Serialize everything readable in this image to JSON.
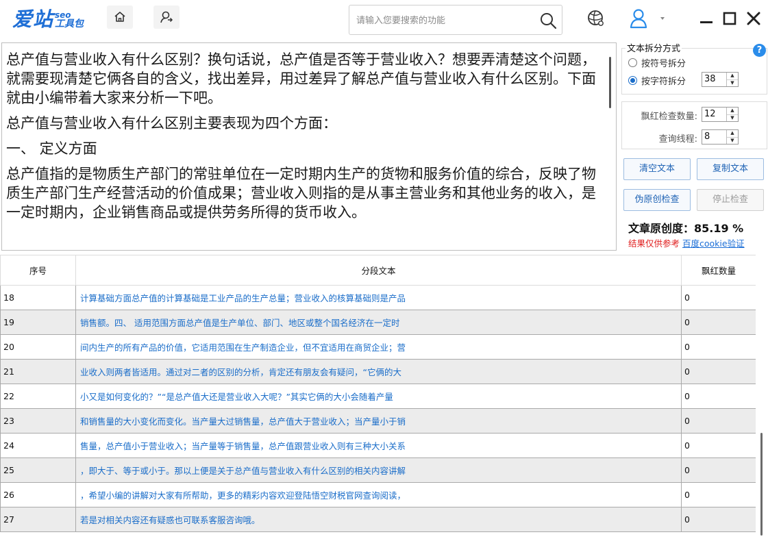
{
  "app": {
    "logo_main": "爱站",
    "logo_seo": "seo",
    "logo_tool": "工具包"
  },
  "header": {
    "search_placeholder": "请输入您要搜索的功能",
    "icons": [
      "home-icon",
      "share-icon",
      "search-icon",
      "globe-icon",
      "user-icon",
      "minimize-icon",
      "maximize-icon",
      "close-icon"
    ]
  },
  "editor": {
    "paragraphs": [
      "总产值与营业收入有什么区别？换句话说，总产值是否等于营业收入？想要弄清楚这个问题，就需要现清楚它俩各自的含义，找出差异，用过差异了解总产值与营业收入有什么区别。下面就由小编带着大家来分析一下吧。",
      "总产值与营业收入有什么区别主要表现为四个方面：",
      "一、 定义方面",
      "总产值指的是物质生产部门的常驻单位在一定时期内生产的货物和服务价值的综合，反映了物质生产部门生产经营活动的价值成果；营业收入则指的是从事主营业务和其他业务的收入，是一定时期内，企业销售商品或提供劳务所得的货币收入。"
    ]
  },
  "panel": {
    "split_title": "文本拆分方式",
    "radio_symbol": "按符号拆分",
    "radio_char": "按字符拆分",
    "char_count": "38",
    "red_check_label": "飘红检查数量:",
    "red_check_value": "12",
    "threads_label": "查询线程:",
    "threads_value": "8",
    "btn_clear": "清空文本",
    "btn_copy": "复制文本",
    "btn_check": "伪原创检查",
    "btn_stop": "停止检查",
    "originality": "文章原创度：85.19 %",
    "note_red": "结果仅供参考",
    "note_link": "百度cookie验证",
    "accent_color": "#1a6dc9",
    "warning_color": "#e02020"
  },
  "table": {
    "headers": [
      "序号",
      "分段文本",
      "飘红数量"
    ],
    "rows": [
      [
        "18",
        "计算基础方面总产值的计算基础是工业产品的生产总量；营业收入的核算基础则是产品",
        "0"
      ],
      [
        "19",
        "销售额。四、 适用范围方面总产值是生产单位、部门、地区或整个国名经济在一定时",
        "0"
      ],
      [
        "20",
        "间内生产的所有产品的价值，它适用范围在生产制造企业，但不宜适用在商贸企业；营",
        "0"
      ],
      [
        "21",
        "业收入则两者皆适用。通过对二者的区别的分析，肯定还有朋友会有疑问，“它俩的大",
        "0"
      ],
      [
        "22",
        "小又是如何变化的？”“是总产值大还是营业收入大呢？”其实它俩的大小会随着产量",
        "0"
      ],
      [
        "23",
        "和销售量的大小变化而变化。当产量大过销售量，总产值大于营业收入；当产量小于销",
        "0"
      ],
      [
        "24",
        "售量，总产值小于营业收入；当产量等于销售量，总产值跟营业收入则有三种大小关系",
        "0"
      ],
      [
        "25",
        "，即大于、等于或小于。那以上便是关于总产值与营业收入有什么区别的相关内容讲解",
        "0"
      ],
      [
        "26",
        "，希望小编的讲解对大家有所帮助，更多的精彩内容欢迎登陆悟空财税官网查询阅读，",
        "0"
      ],
      [
        "27",
        "若是对相关内容还有疑惑也可联系客服咨询哦。",
        "0"
      ]
    ]
  }
}
